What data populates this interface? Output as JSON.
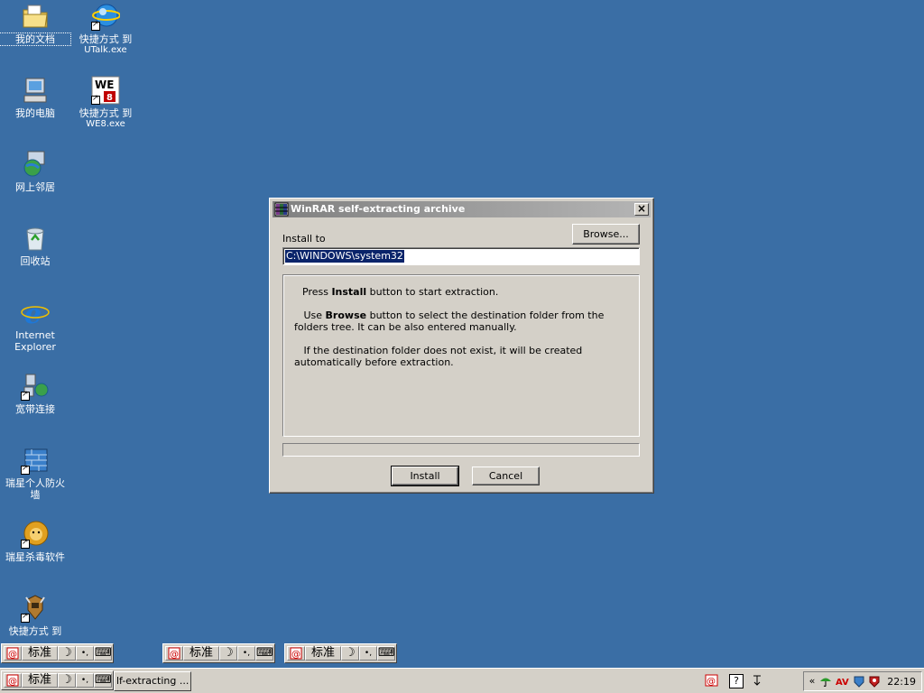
{
  "desktop": {
    "icons": [
      {
        "name": "我的文档"
      },
      {
        "name": "快捷方式 到",
        "sub": "UTalk.exe"
      },
      {
        "name": "我的电脑"
      },
      {
        "name": "快捷方式 到",
        "sub": "WE8.exe"
      },
      {
        "name": "网上邻居"
      },
      {
        "name": "回收站"
      },
      {
        "name": "Internet Explorer"
      },
      {
        "name": "宽带连接"
      },
      {
        "name": "瑞星个人防火墙"
      },
      {
        "name": "瑞星杀毒软件"
      },
      {
        "name": "快捷方式 到"
      }
    ]
  },
  "dialog": {
    "title": "WinRAR self-extracting archive",
    "close": "×",
    "install_to_label": "Install to",
    "browse_button": "Browse...",
    "path_value": "C:\\WINDOWS\\system32",
    "info": {
      "p1_pre": "Press ",
      "p1_bold": "Install",
      "p1_post": " button to start extraction.",
      "p2_pre": "Use ",
      "p2_bold": "Browse",
      "p2_post": " button to select the destination folder from the folders tree. It can be also entered manually.",
      "p3": "If the destination folder does not exist, it will be created automatically before extraction."
    },
    "install_button": "Install",
    "cancel_button": "Cancel"
  },
  "ime": {
    "mode_label": "标准",
    "moon": "☽",
    "punct": "•,",
    "keyboard": "⌨"
  },
  "taskbar": {
    "task_label": "lf-extracting ...",
    "clock": "22:19",
    "tray_expand": "«",
    "help": "?"
  },
  "colors": {
    "desktop": "#3a6ea5",
    "title_inactive_start": "#808080",
    "title_inactive_end": "#b5b5b5",
    "selection": "#0a246a"
  }
}
